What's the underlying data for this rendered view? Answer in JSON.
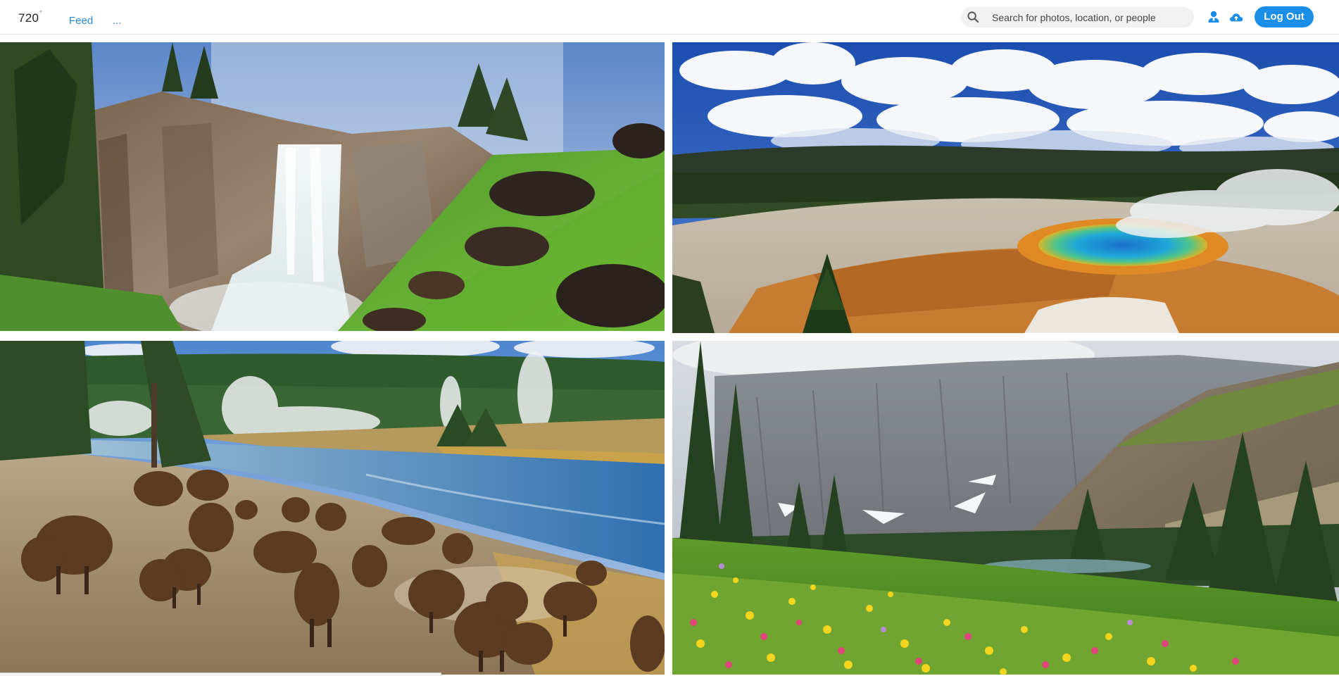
{
  "app": {
    "logo_text": "720",
    "logo_superscript": "°"
  },
  "nav": {
    "feed_label": "Feed",
    "more_label": "..."
  },
  "search": {
    "placeholder": "Search for photos, location, or people",
    "value": ""
  },
  "header_icons": {
    "search": "search-icon",
    "user": "user-icon",
    "upload": "cloud-upload-icon"
  },
  "account": {
    "logout_label": "Log Out"
  },
  "colors": {
    "brand_blue": "#1a8ee6",
    "link_blue": "#2a86d6"
  },
  "photos": [
    {
      "subject": "waterfall-canyon"
    },
    {
      "subject": "hot-spring-basin"
    },
    {
      "subject": "bison-herd-river"
    },
    {
      "subject": "alpine-wildflower-meadow"
    }
  ],
  "status_bar": {
    "url_text": ""
  }
}
